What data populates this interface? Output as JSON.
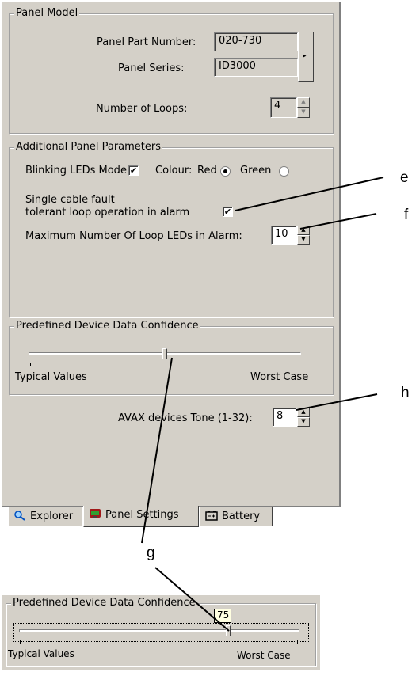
{
  "panel_model": {
    "title": "Panel Model",
    "part_number_label": "Panel Part Number:",
    "part_number_value": "020-730",
    "series_label": "Panel Series:",
    "series_value": "ID3000",
    "loops_label": "Number of Loops:",
    "loops_value": "4"
  },
  "additional": {
    "title": "Additional Panel Parameters",
    "blinking_label": "Blinking LEDs Mode",
    "blinking_checked": true,
    "colour_label": "Colour:",
    "red_label": "Red",
    "green_label": "Green",
    "selected_colour": "Red",
    "single_cable_line1": "Single cable fault",
    "single_cable_line2": "tolerant loop operation in alarm",
    "single_cable_checked": true,
    "max_leds_label": "Maximum Number Of Loop LEDs in Alarm:",
    "max_leds_value": "10"
  },
  "confidence": {
    "title": "Predefined Device Data Confidence",
    "min_label": "Typical Values",
    "max_label": "Worst Case",
    "level": 0.5
  },
  "avax": {
    "label": "AVAX  devices Tone (1-32):",
    "value": "8"
  },
  "tabs": [
    {
      "label": "Explorer",
      "icon": "magnifier-icon"
    },
    {
      "label": "Panel Settings",
      "icon": "panel-icon",
      "active": true
    },
    {
      "label": "Battery",
      "icon": "battery-icon"
    }
  ],
  "callouts": {
    "e": "e",
    "f": "f",
    "g": "g",
    "h": "h"
  },
  "zoom": {
    "title": "Predefined Device Data Confidence",
    "tooltip_value": "75",
    "min_label": "Typical Values",
    "max_label": "Worst Case",
    "level": 0.75
  },
  "colors": {
    "face": "#d4d0c8",
    "tooltip": "#ffffe1"
  }
}
